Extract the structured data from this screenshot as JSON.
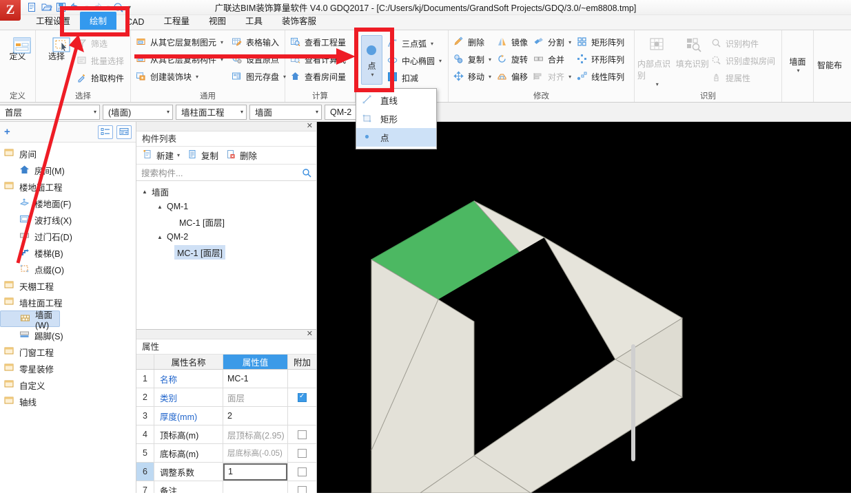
{
  "app": {
    "title": "广联达BIM装饰算量软件 V4.0 GDQ2017 - [C:/Users/kj/Documents/GrandSoft Projects/GDQ/3.0/~em8808.tmp]"
  },
  "quick_access": {
    "icons": [
      "new-file-icon",
      "open-folder-icon",
      "save-icon",
      "undo-icon",
      "redo-icon",
      "print-preview-icon",
      "more-icon"
    ]
  },
  "menu": {
    "tabs": [
      {
        "label": "工程设置",
        "active": false
      },
      {
        "label": "绘制",
        "active": true
      },
      {
        "label": "CAD",
        "active": false
      },
      {
        "label": "工程量",
        "active": false
      },
      {
        "label": "视图",
        "active": false
      },
      {
        "label": "工具",
        "active": false
      },
      {
        "label": "装饰客服",
        "active": false
      }
    ]
  },
  "ribbon": {
    "groups": [
      {
        "label": "定义",
        "big": [
          {
            "label": "定义",
            "icon": "definition-icon"
          }
        ]
      },
      {
        "label": "选择",
        "big": [
          {
            "label": "选择",
            "icon": "select-arrow-icon"
          }
        ],
        "small": [
          {
            "label": "筛选",
            "icon": "filter-icon",
            "disabled": true,
            "caret": false
          },
          {
            "label": "批量选择",
            "icon": "batch-select-icon",
            "disabled": true,
            "caret": false
          },
          {
            "label": "拾取构件",
            "icon": "pick-component-icon",
            "disabled": false,
            "caret": false
          }
        ]
      },
      {
        "label": "通用",
        "colA": [
          {
            "label": "从其它层复制图元",
            "icon": "copy-element-icon",
            "caret": true
          },
          {
            "label": "从其它层复制构件",
            "icon": "copy-component-icon",
            "caret": true
          },
          {
            "label": "创建装饰块",
            "icon": "create-decor-block-icon",
            "caret": true
          }
        ],
        "colB": [
          {
            "label": "表格输入",
            "icon": "table-input-icon",
            "caret": false
          },
          {
            "label": "设置原点",
            "icon": "set-origin-icon",
            "caret": false
          },
          {
            "label": "图元存盘",
            "icon": "save-element-icon",
            "caret": true
          }
        ]
      },
      {
        "label": "计算",
        "small": [
          {
            "label": "查看工程量",
            "icon": "view-quantity-icon"
          },
          {
            "label": "查看计算式",
            "icon": "view-formula-icon"
          },
          {
            "label": "查看房间量",
            "icon": "view-room-quantity-icon"
          }
        ]
      },
      {
        "label": "",
        "big": [
          {
            "label": "点",
            "icon": "point-icon",
            "selected": true,
            "caret": true
          }
        ],
        "small": [
          {
            "label": "三点弧",
            "icon": "three-point-arc-icon",
            "caret": true
          },
          {
            "label": "中心椭圆",
            "icon": "center-ellipse-icon",
            "caret": true
          },
          {
            "label": "扣减",
            "icon": "deduct-checkbox",
            "checkbox": true,
            "checked": true
          }
        ]
      },
      {
        "label": "修改",
        "colA": [
          {
            "label": "删除",
            "icon": "delete-icon"
          },
          {
            "label": "复制",
            "icon": "copy-icon",
            "caret": true
          },
          {
            "label": "移动",
            "icon": "move-icon",
            "caret": true
          }
        ],
        "colB": [
          {
            "label": "镜像",
            "icon": "mirror-icon"
          },
          {
            "label": "旋转",
            "icon": "rotate-icon"
          },
          {
            "label": "偏移",
            "icon": "offset-icon"
          }
        ],
        "colC": [
          {
            "label": "分割",
            "icon": "split-icon",
            "caret": true
          },
          {
            "label": "合并",
            "icon": "merge-icon"
          },
          {
            "label": "对齐",
            "icon": "align-icon",
            "caret": true,
            "disabled": true
          }
        ],
        "colD": [
          {
            "label": "矩形阵列",
            "icon": "rect-array-icon"
          },
          {
            "label": "环形阵列",
            "icon": "ring-array-icon"
          },
          {
            "label": "线性阵列",
            "icon": "linear-array-icon"
          }
        ]
      },
      {
        "label": "识别",
        "big": [
          {
            "label": "内部点识别",
            "icon": "inner-point-recognize-icon",
            "disabled": true,
            "caret": true
          },
          {
            "label": "填充识别",
            "icon": "fill-recognize-icon",
            "disabled": true
          }
        ],
        "small": [
          {
            "label": "识别构件",
            "icon": "recognize-component-icon",
            "disabled": true
          },
          {
            "label": "识别虚拟房间",
            "icon": "recognize-virtual-room-icon",
            "disabled": true
          },
          {
            "label": "提属性",
            "icon": "extract-property-icon",
            "disabled": true
          }
        ]
      },
      {
        "label": "",
        "big": [
          {
            "label": "墙面",
            "icon": "wall-surface-icon",
            "caret": true
          }
        ]
      },
      {
        "label": "",
        "big": [
          {
            "label": "智能布",
            "icon": "smart-layout-icon"
          }
        ]
      }
    ]
  },
  "point_menu": {
    "items": [
      {
        "label": "直线",
        "icon": "line-icon",
        "selected": false
      },
      {
        "label": "矩形",
        "icon": "rectangle-icon",
        "selected": false
      },
      {
        "label": "点",
        "icon": "point-dot-icon",
        "selected": true
      }
    ]
  },
  "selector_bar": {
    "floor": "首层",
    "category": "(墙面)",
    "project": "墙柱面工程",
    "element": "墙面",
    "component": "QM-2"
  },
  "sidebar": {
    "add_label": "+",
    "view_buttons": [
      "list-view-icon",
      "detail-view-icon"
    ],
    "tree": [
      {
        "label": "房间",
        "level": 0,
        "icon": "folder-icon"
      },
      {
        "label": "房间(M)",
        "level": 1,
        "icon": "room-icon"
      },
      {
        "label": "楼地面工程",
        "level": 0,
        "icon": "folder-icon"
      },
      {
        "label": "楼地面(F)",
        "level": 1,
        "icon": "floor-icon"
      },
      {
        "label": "波打线(X)",
        "level": 1,
        "icon": "border-line-icon"
      },
      {
        "label": "过门石(D)",
        "level": 1,
        "icon": "door-stone-icon"
      },
      {
        "label": "楼梯(B)",
        "level": 1,
        "icon": "stairs-icon"
      },
      {
        "label": "点缀(O)",
        "level": 1,
        "icon": "ornament-icon"
      },
      {
        "label": "天棚工程",
        "level": 0,
        "icon": "folder-icon"
      },
      {
        "label": "墙柱面工程",
        "level": 0,
        "icon": "folder-icon"
      },
      {
        "label": "墙面(W)",
        "level": 1,
        "icon": "wall-icon",
        "selected": true
      },
      {
        "label": "踢脚(S)",
        "level": 1,
        "icon": "skirting-icon"
      },
      {
        "label": "门窗工程",
        "level": 0,
        "icon": "folder-icon"
      },
      {
        "label": "零星装修",
        "level": 0,
        "icon": "folder-icon"
      },
      {
        "label": "自定义",
        "level": 0,
        "icon": "folder-icon"
      },
      {
        "label": "轴线",
        "level": 0,
        "icon": "folder-icon"
      }
    ]
  },
  "component_list": {
    "panel_title": "构件列表",
    "close_icon": "close-icon",
    "toolbar": [
      {
        "label": "新建",
        "icon": "new-icon",
        "caret": true
      },
      {
        "label": "复制",
        "icon": "copy-doc-icon",
        "caret": false
      },
      {
        "label": "删除",
        "icon": "delete-doc-icon",
        "caret": false
      }
    ],
    "search_placeholder": "搜索构件...",
    "search_icon": "search-icon",
    "tree": [
      {
        "label": "墙面",
        "level": 0,
        "expander": "▲"
      },
      {
        "label": "QM-1",
        "level": 1,
        "expander": "▲"
      },
      {
        "label": "MC-1 [面层]",
        "level": 2,
        "expander": ""
      },
      {
        "label": "QM-2",
        "level": 1,
        "expander": "▲"
      },
      {
        "label": "MC-1 [面层]",
        "level": 2,
        "expander": "",
        "selected": true
      }
    ]
  },
  "properties": {
    "panel_title": "属性",
    "close_icon": "close-icon",
    "headers": [
      "",
      "属性名称",
      "属性值",
      "附加"
    ],
    "rows": [
      {
        "idx": "1",
        "name": "名称",
        "name_color": "blue",
        "value": "MC-1",
        "value_color": "normal",
        "add": "none"
      },
      {
        "idx": "2",
        "name": "类别",
        "name_color": "blue",
        "value": "面层",
        "value_color": "gray",
        "add": "checked"
      },
      {
        "idx": "3",
        "name": "厚度(mm)",
        "name_color": "blue",
        "value": "2",
        "value_color": "normal",
        "add": "none"
      },
      {
        "idx": "4",
        "name": "顶标高(m)",
        "name_color": "normal",
        "value": "层顶标高(2.95)",
        "value_color": "gray",
        "add": "unchecked"
      },
      {
        "idx": "5",
        "name": "底标高(m)",
        "name_color": "normal",
        "value": "层底标高(-0.05)",
        "value_color": "gray",
        "add": "unchecked"
      },
      {
        "idx": "6",
        "name": "调整系数",
        "name_color": "normal",
        "value": "1",
        "value_color": "normal",
        "add": "unchecked",
        "selected": true,
        "editing": true
      },
      {
        "idx": "7",
        "name": "备注",
        "name_color": "normal",
        "value": "",
        "value_color": "normal",
        "add": "unchecked"
      }
    ]
  },
  "viewport": {
    "background": "#000000",
    "wall_color": "#e3e1d8",
    "wall_shade_color": "#d9d7cd",
    "highlight_color": "#4cb862",
    "outline_color": "#9c9a90"
  },
  "annotations": {
    "color": "#ee1c25",
    "boxes": [
      "draw-tab-highlight",
      "point-button-highlight"
    ],
    "arrows": [
      "arrow-to-draw-tab",
      "arrow-to-point-button"
    ]
  }
}
